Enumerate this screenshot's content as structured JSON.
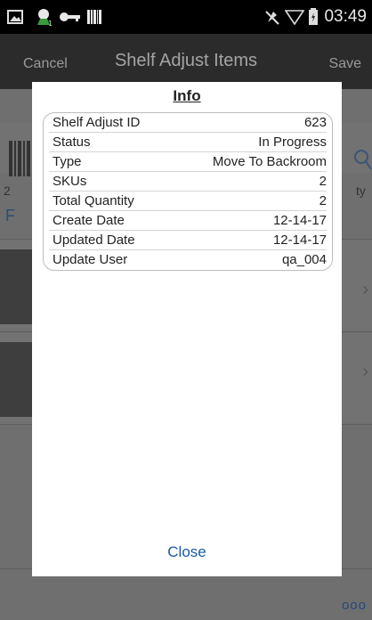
{
  "status_bar": {
    "time": "03:49",
    "icons": [
      "image-icon",
      "notification-icon",
      "key-icon",
      "barcode-icon",
      "mute-icon",
      "wifi-icon",
      "battery-icon"
    ]
  },
  "title_bar": {
    "cancel_label": "Cancel",
    "title": "Shelf Adjust Items",
    "save_label": "Save"
  },
  "background": {
    "count_text": "2",
    "quantity_text_fragment": "ty",
    "link_fragment": "F",
    "more_label": "ooo"
  },
  "dialog": {
    "title": "Info",
    "rows": [
      {
        "label": "Shelf Adjust ID",
        "value": "623"
      },
      {
        "label": "Status",
        "value": "In Progress"
      },
      {
        "label": "Type",
        "value": "Move To Backroom"
      },
      {
        "label": "SKUs",
        "value": "2"
      },
      {
        "label": "Total Quantity",
        "value": "2"
      },
      {
        "label": "Create Date",
        "value": "12-14-17"
      },
      {
        "label": "Updated Date",
        "value": "12-14-17"
      },
      {
        "label": "Update User",
        "value": "qa_004"
      }
    ],
    "close_label": "Close"
  },
  "colors": {
    "accent": "#1c5aa0",
    "title_bar": "#2b2b2b",
    "overlay": "#6f6f6f"
  }
}
